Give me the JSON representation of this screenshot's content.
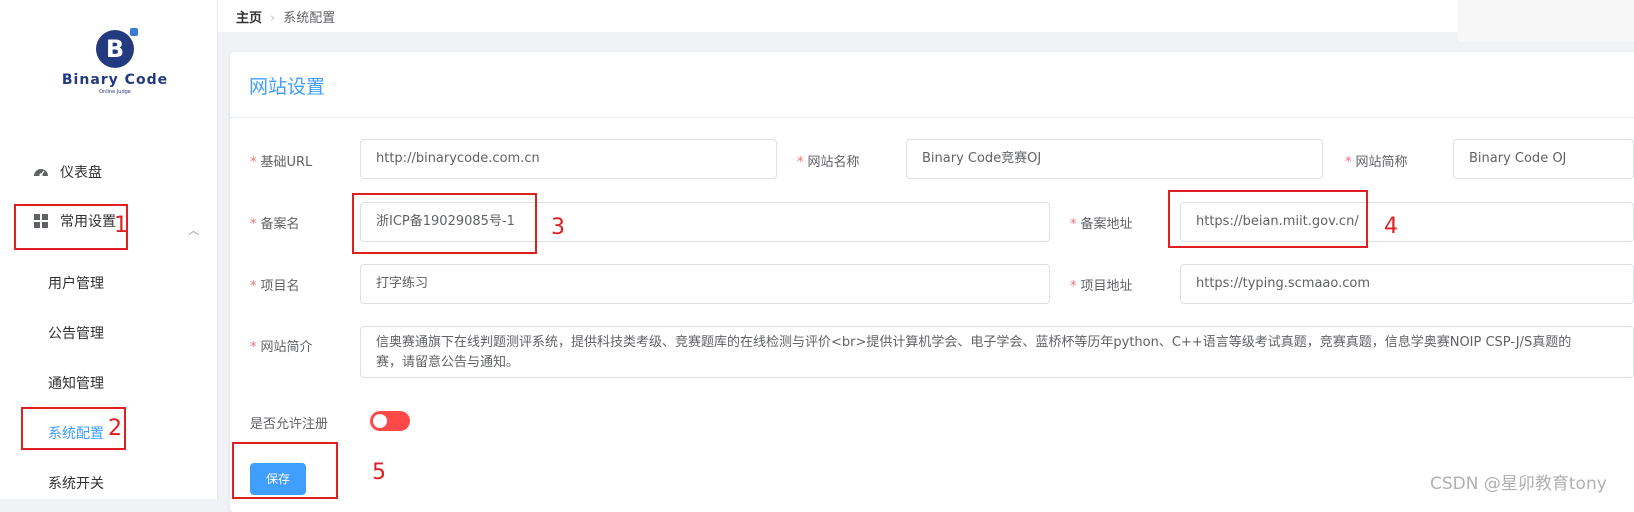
{
  "app": {
    "logo_text": "Binary Code",
    "logo_sub": "Online Judge",
    "logo_letter": "B"
  },
  "sidebar": {
    "dashboard": "仪表盘",
    "settings_group": "常用设置",
    "sub_items": [
      "用户管理",
      "公告管理",
      "通知管理",
      "系统配置",
      "系统开关"
    ]
  },
  "breadcrumb": {
    "home": "主页",
    "current": "系统配置"
  },
  "card": {
    "title": "网站设置"
  },
  "form": {
    "base_url": {
      "label": "基础URL",
      "value": "http://binarycode.com.cn"
    },
    "site_name": {
      "label": "网站名称",
      "value": "Binary Code竞赛OJ"
    },
    "site_short": {
      "label": "网站简称",
      "value": "Binary Code OJ"
    },
    "record_name": {
      "label": "备案名",
      "value": "浙ICP备19029085号-1"
    },
    "record_url": {
      "label": "备案地址",
      "value": "https://beian.miit.gov.cn/"
    },
    "project_name": {
      "label": "项目名",
      "value": "打字练习"
    },
    "project_url": {
      "label": "项目地址",
      "value": "https://typing.scmaao.com"
    },
    "intro": {
      "label": "网站简介",
      "value_line1": "信奥赛通旗下在线判题测评系统，提供科技类考级、竞赛题库的在线检测与评价<br>提供计算机学会、电子学会、蓝桥杯等历年python、C++语言等级考试真题，竞赛真题，信息学奥赛NOIP CSP-J/S真题的",
      "value_line2": "赛，请留意公告与通知。"
    },
    "allow_register": {
      "label": "是否允许注册",
      "enabled": false
    },
    "save_label": "保存"
  },
  "annotations": [
    "1",
    "2",
    "3",
    "4",
    "5"
  ],
  "watermark": "CSDN @星卯教育tony",
  "colors": {
    "accent": "#409eff",
    "required": "#f56c6c",
    "annotation": "#e02020",
    "toggle_off": "#ff4949"
  }
}
